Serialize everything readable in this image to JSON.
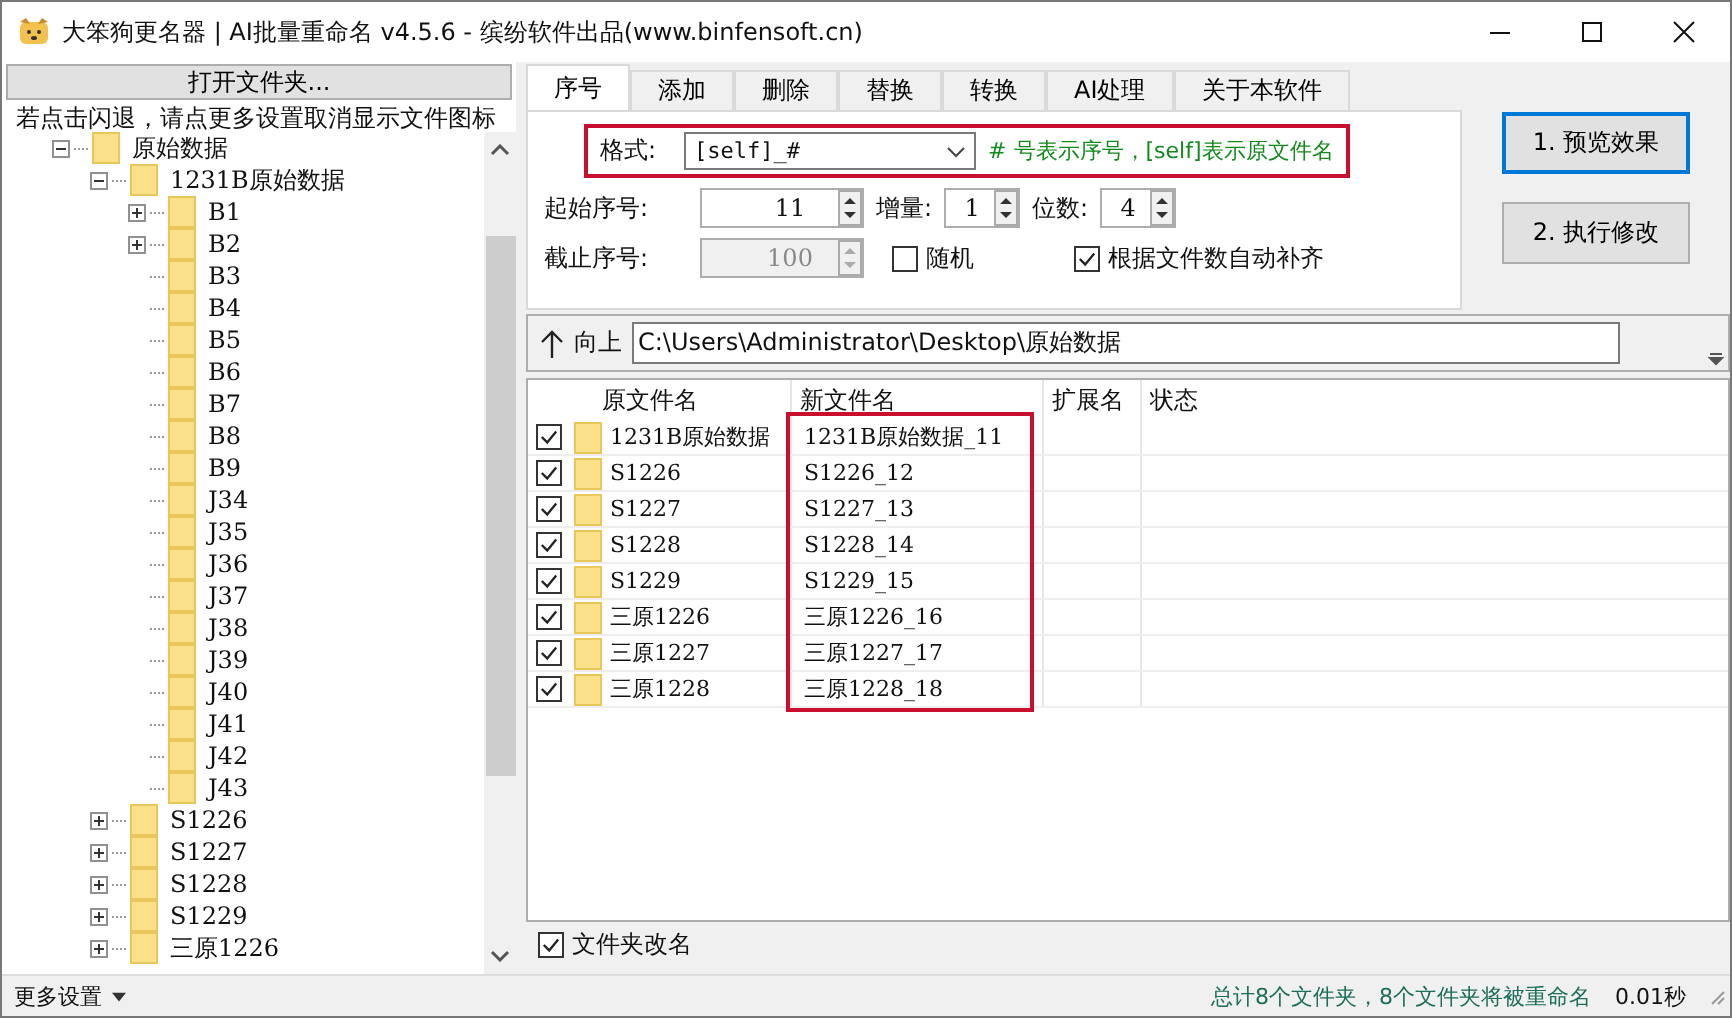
{
  "window": {
    "title": "大笨狗更名器 | AI批量重命名 v4.5.6 - 缤纷软件出品(www.binfensoft.cn)"
  },
  "sidebar": {
    "open_button": "打开文件夹...",
    "hint": "若点击闪退，请点更多设置取消显示文件图标",
    "tree": [
      {
        "label": "原始数据",
        "expanded": true,
        "children": [
          {
            "label": "1231B原始数据",
            "expanded": true,
            "children": [
              {
                "label": "B1",
                "expanded": false
              },
              {
                "label": "B2",
                "expanded": false
              },
              {
                "label": "B3"
              },
              {
                "label": "B4"
              },
              {
                "label": "B5"
              },
              {
                "label": "B6"
              },
              {
                "label": "B7"
              },
              {
                "label": "B8"
              },
              {
                "label": "B9"
              },
              {
                "label": "J34"
              },
              {
                "label": "J35"
              },
              {
                "label": "J36"
              },
              {
                "label": "J37"
              },
              {
                "label": "J38"
              },
              {
                "label": "J39"
              },
              {
                "label": "J40"
              },
              {
                "label": "J41"
              },
              {
                "label": "J42"
              },
              {
                "label": "J43"
              }
            ]
          },
          {
            "label": "S1226",
            "expanded": false
          },
          {
            "label": "S1227",
            "expanded": false
          },
          {
            "label": "S1228",
            "expanded": false
          },
          {
            "label": "S1229",
            "expanded": false
          },
          {
            "label": "三原1226",
            "expanded": false
          }
        ]
      }
    ],
    "more_settings": "更多设置"
  },
  "tabs": [
    {
      "label": "序号",
      "selected": true
    },
    {
      "label": "添加",
      "selected": false
    },
    {
      "label": "删除",
      "selected": false
    },
    {
      "label": "替换",
      "selected": false
    },
    {
      "label": "转换",
      "selected": false
    },
    {
      "label": "AI处理",
      "selected": false
    },
    {
      "label": "关于本软件",
      "selected": false
    }
  ],
  "numbering": {
    "format_label": "格式:",
    "format_value": "[self]_#",
    "format_hint": "# 号表示序号，[self]表示原文件名",
    "start_label": "起始序号:",
    "start_value": "11",
    "step_label": "增量:",
    "step_value": "1",
    "digits_label": "位数:",
    "digits_value": "4",
    "end_label": "截止序号:",
    "end_value": "100",
    "end_disabled": true,
    "random_label": "随机",
    "random_checked": false,
    "autopad_label": "根据文件数自动补齐",
    "autopad_checked": true
  },
  "actions": [
    {
      "label": "1. 预览效果",
      "focused": true
    },
    {
      "label": "2. 执行修改",
      "focused": false
    }
  ],
  "path_bar": {
    "up_label": "向上",
    "path": "C:\\Users\\Administrator\\Desktop\\原始数据"
  },
  "table": {
    "columns": [
      "原文件名",
      "新文件名",
      "扩展名",
      "状态"
    ],
    "rows": [
      {
        "checked": true,
        "original": "1231B原始数据",
        "new_name": "1231B原始数据_11"
      },
      {
        "checked": true,
        "original": "S1226",
        "new_name": "S1226_12"
      },
      {
        "checked": true,
        "original": "S1227",
        "new_name": "S1227_13"
      },
      {
        "checked": true,
        "original": "S1228",
        "new_name": "S1228_14"
      },
      {
        "checked": true,
        "original": "S1229",
        "new_name": "S1229_15"
      },
      {
        "checked": true,
        "original": "三原1226",
        "new_name": "三原1226_16"
      },
      {
        "checked": true,
        "original": "三原1227",
        "new_name": "三原1227_17"
      },
      {
        "checked": true,
        "original": "三原1228",
        "new_name": "三原1228_18"
      }
    ]
  },
  "folder_rename": {
    "label": "文件夹改名",
    "checked": true
  },
  "status_bar": {
    "summary": "总计8个文件夹，8个文件夹将被重命名",
    "time": "0.01秒"
  }
}
